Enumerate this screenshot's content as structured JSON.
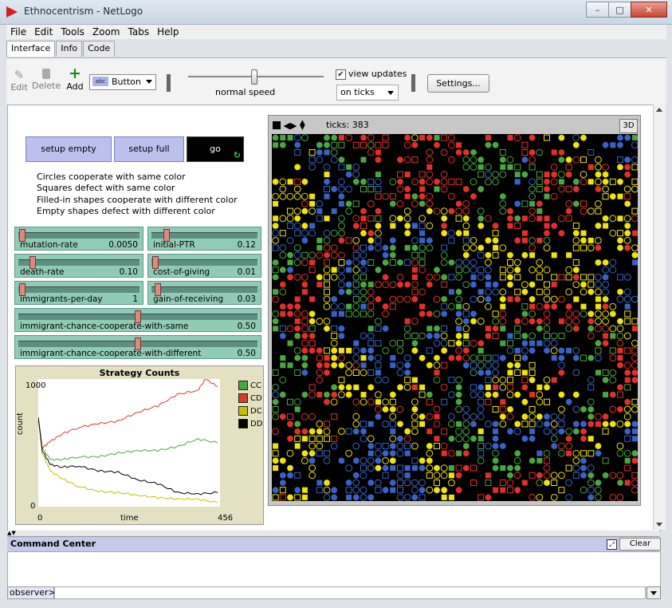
{
  "window": {
    "title": "Ethnocentrism - NetLogo",
    "min": "–",
    "max": "□",
    "close": "✕"
  },
  "menu": [
    "File",
    "Edit",
    "Tools",
    "Zoom",
    "Tabs",
    "Help"
  ],
  "tabs": [
    "Interface",
    "Info",
    "Code"
  ],
  "toolbar": {
    "edit": "Edit",
    "delete": "Delete",
    "add": "Add",
    "widget_type": "Button",
    "widget_type_icon": "abc",
    "speed_label": "normal speed",
    "view_updates_label": "view updates",
    "view_updates_checked": true,
    "update_mode": "on ticks",
    "settings": "Settings..."
  },
  "buttons": {
    "setup_empty": "setup empty",
    "setup_full": "setup full",
    "go": "go"
  },
  "note": [
    "Circles cooperate with same color",
    "Squares defect with same color",
    "Filled-in shapes cooperate with different color",
    "Empty shapes defect with different color"
  ],
  "sliders": [
    {
      "name": "mutation-rate",
      "value": "0.0050",
      "fraction": 0.01
    },
    {
      "name": "initial-PTR",
      "value": "0.12",
      "fraction": 0.12
    },
    {
      "name": "death-rate",
      "value": "0.10",
      "fraction": 0.1
    },
    {
      "name": "cost-of-giving",
      "value": "0.01",
      "fraction": 0.01
    },
    {
      "name": "immigrants-per-day",
      "value": "1",
      "fraction": 0.01
    },
    {
      "name": "gain-of-receiving",
      "value": "0.03",
      "fraction": 0.03
    },
    {
      "name": "immigrant-chance-cooperate-with-same",
      "value": "0.50",
      "fraction": 0.5
    },
    {
      "name": "immigrant-chance-cooperate-with-different",
      "value": "0.50",
      "fraction": 0.5
    }
  ],
  "view": {
    "ticks_label": "ticks: 383",
    "btn3d": "3D"
  },
  "command_center": {
    "title": "Command Center",
    "clear": "Clear",
    "observer": "observer>"
  },
  "chart_data": {
    "type": "line",
    "title": "Strategy Counts",
    "xlabel": "time",
    "ylabel": "count",
    "xlim": [
      0,
      456
    ],
    "ylim": [
      0,
      1000
    ],
    "x_tick_labels": [
      "0",
      "456"
    ],
    "y_tick_labels": [
      "0",
      "1000"
    ],
    "legend_position": "right",
    "series": [
      {
        "name": "CC",
        "color": "#4aa543",
        "x": [
          0,
          10,
          30,
          60,
          100,
          150,
          200,
          250,
          300,
          350,
          400,
          450
        ],
        "y": [
          700,
          460,
          370,
          370,
          390,
          390,
          420,
          440,
          440,
          470,
          530,
          500
        ]
      },
      {
        "name": "CD",
        "color": "#d63c2c",
        "x": [
          0,
          10,
          30,
          60,
          100,
          150,
          200,
          250,
          300,
          350,
          400,
          420,
          450
        ],
        "y": [
          700,
          460,
          510,
          570,
          620,
          650,
          670,
          740,
          790,
          880,
          910,
          1000,
          940
        ]
      },
      {
        "name": "DC",
        "color": "#c7c000",
        "x": [
          0,
          10,
          30,
          60,
          100,
          150,
          200,
          250,
          300,
          350,
          400,
          450
        ],
        "y": [
          700,
          420,
          280,
          220,
          160,
          120,
          110,
          90,
          70,
          60,
          60,
          30
        ]
      },
      {
        "name": "DD",
        "color": "#000000",
        "x": [
          0,
          10,
          30,
          60,
          100,
          150,
          200,
          250,
          300,
          350,
          400,
          450
        ],
        "y": [
          700,
          440,
          330,
          310,
          320,
          280,
          270,
          210,
          180,
          110,
          100,
          110
        ]
      }
    ]
  },
  "world": {
    "colors": {
      "red": "#e0302a",
      "green": "#4aa543",
      "blue": "#3a62c4",
      "yellow": "#eee20f"
    }
  }
}
